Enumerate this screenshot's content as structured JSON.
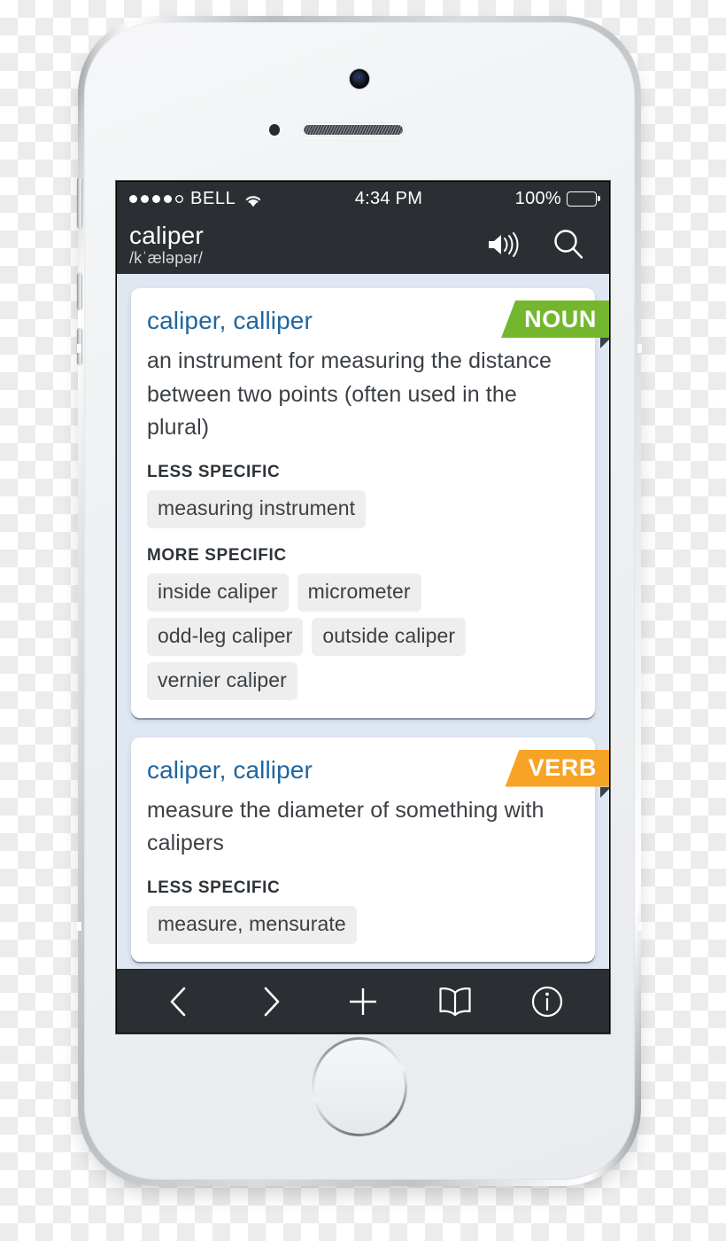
{
  "status_bar": {
    "signal_dots_total": 5,
    "signal_dots_filled": 4,
    "carrier": "BELL",
    "wifi_icon": "wifi-icon",
    "time": "4:34 PM",
    "battery_percent": "100%",
    "battery_level": 100
  },
  "nav_bar": {
    "word": "caliper",
    "pronunciation": "/kˈæləpər/",
    "speaker_icon": "speaker-icon",
    "search_icon": "search-icon"
  },
  "entries": [
    {
      "headword": "caliper, calliper",
      "pos": "NOUN",
      "pos_color": "#74b72e",
      "definition": "an instrument for measuring the distance between two points (often used in the plural)",
      "relations": [
        {
          "label": "LESS SPECIFIC",
          "terms": [
            "measuring instrument"
          ]
        },
        {
          "label": "MORE SPECIFIC",
          "terms": [
            "inside caliper",
            "micrometer",
            "odd-leg caliper",
            "outside caliper",
            "vernier caliper"
          ]
        }
      ]
    },
    {
      "headword": "caliper, calliper",
      "pos": "VERB",
      "pos_color": "#f7a325",
      "definition": "measure the diameter of something with calipers",
      "relations": [
        {
          "label": "LESS SPECIFIC",
          "terms": [
            "measure, mensurate"
          ]
        }
      ]
    }
  ],
  "toolbar": {
    "items": [
      {
        "name": "back-button",
        "icon": "chevron-left-icon"
      },
      {
        "name": "forward-button",
        "icon": "chevron-right-icon"
      },
      {
        "name": "add-button",
        "icon": "plus-icon"
      },
      {
        "name": "bookmarks-button",
        "icon": "book-icon"
      },
      {
        "name": "info-button",
        "icon": "info-icon"
      }
    ]
  },
  "theme": {
    "chrome_bg": "#2b2f33",
    "page_bg": "#dfe7f2",
    "headword_color": "#20669f",
    "chip_bg": "#eeeeee"
  }
}
